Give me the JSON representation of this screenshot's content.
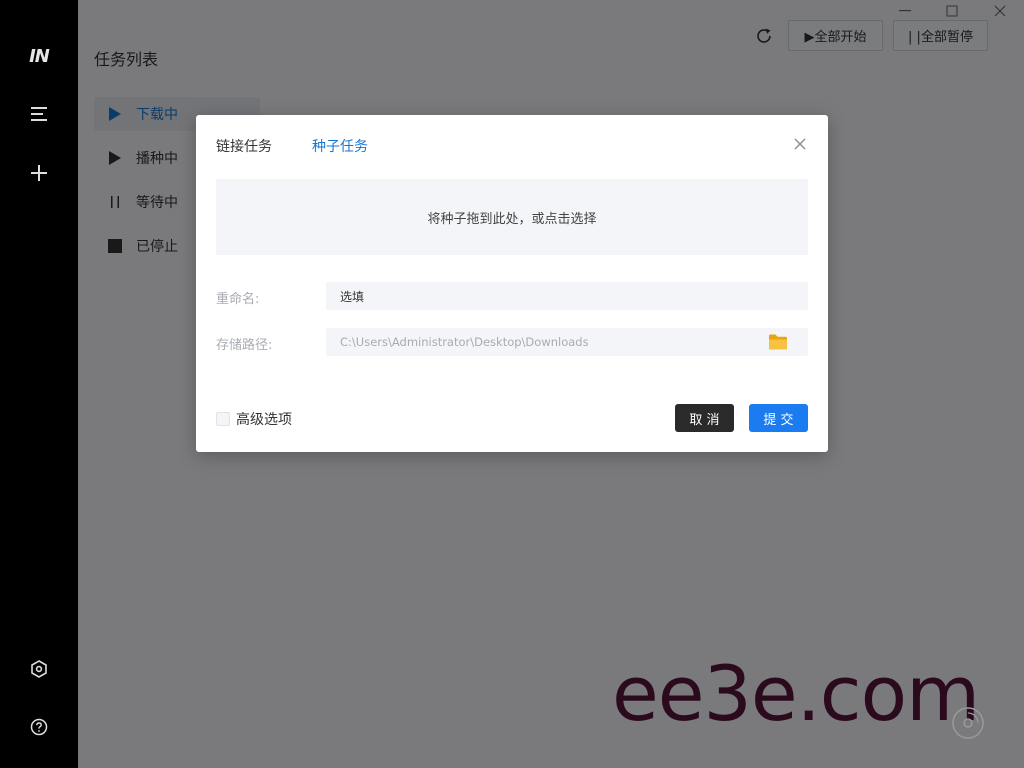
{
  "app": {
    "logo_text": "IN"
  },
  "sidebar": {
    "title": "任务列表",
    "items": [
      {
        "label": "下载中",
        "icon": "play-icon",
        "active": true
      },
      {
        "label": "播种中",
        "icon": "play-icon",
        "active": false
      },
      {
        "label": "等待中",
        "icon": "pause-icon",
        "active": false
      },
      {
        "label": "已停止",
        "icon": "stop-icon",
        "active": false
      }
    ]
  },
  "toolbar": {
    "start_all_label": "▶全部开始",
    "pause_all_label": "| |全部暂停"
  },
  "dialog": {
    "tabs": [
      {
        "label": "链接任务",
        "active": false
      },
      {
        "label": "种子任务",
        "active": true
      }
    ],
    "dropzone_text": "将种子拖到此处，或点击选择",
    "rename_label": "重命名:",
    "rename_value": "选填",
    "path_label": "存储路径:",
    "path_value": "C:\\Users\\Administrator\\Desktop\\Downloads",
    "advanced_label": "高级选项",
    "advanced_checked": false,
    "cancel_label": "取 消",
    "submit_label": "提 交"
  },
  "watermark": {
    "text": "ee3e.com"
  },
  "colors": {
    "accent": "#1677d2",
    "submit": "#1a7cf0",
    "cancel": "#2a2a2a",
    "rail": "#000000",
    "watermark": "#2b0a1e"
  }
}
